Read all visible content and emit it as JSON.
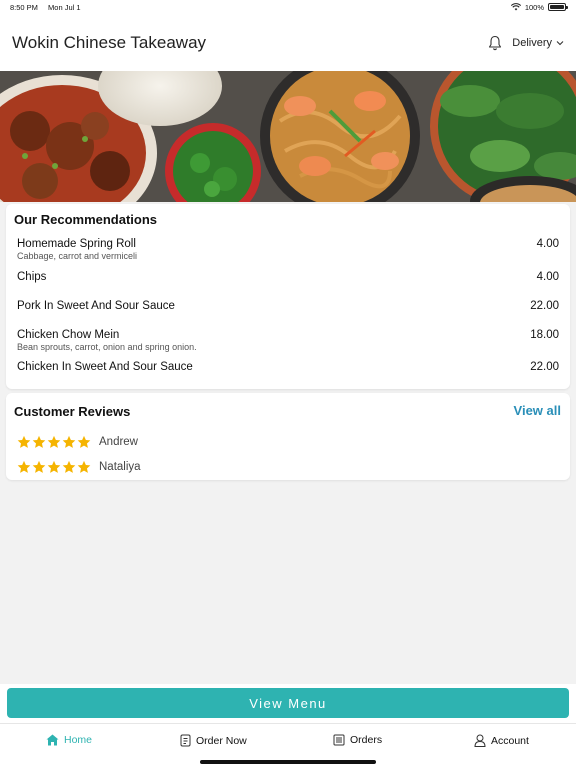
{
  "status_bar": {
    "time": "8:50 PM",
    "date": "Mon Jul 1",
    "battery": "100%"
  },
  "header": {
    "title": "Wokin Chinese Takeaway",
    "mode_label": "Delivery"
  },
  "recommendations": {
    "title": "Our Recommendations",
    "items": [
      {
        "name": "Homemade Spring Roll",
        "desc": "Cabbage, carrot and vermiceli",
        "price": "4.00"
      },
      {
        "name": "Chips",
        "desc": "",
        "price": "4.00"
      },
      {
        "name": "Pork In Sweet And Sour Sauce",
        "desc": "",
        "price": "22.00"
      },
      {
        "name": "Chicken Chow Mein",
        "desc": "Bean sprouts, carrot, onion and spring onion.",
        "price": "18.00"
      },
      {
        "name": "Chicken In Sweet And Sour Sauce",
        "desc": "",
        "price": "22.00"
      }
    ]
  },
  "reviews": {
    "title": "Customer Reviews",
    "view_all_label": "View all",
    "items": [
      {
        "name": "Andrew",
        "rating": 5
      },
      {
        "name": "Nataliya",
        "rating": 5
      }
    ]
  },
  "view_menu_label": "View Menu",
  "tabs": [
    {
      "label": "Home",
      "icon": "home-icon",
      "active": true
    },
    {
      "label": "Order Now",
      "icon": "order-icon",
      "active": false
    },
    {
      "label": "Orders",
      "icon": "orders-icon",
      "active": false
    },
    {
      "label": "Account",
      "icon": "account-icon",
      "active": false
    }
  ],
  "colors": {
    "accent": "#2eb3b1",
    "link": "#2a8fb8",
    "star": "#f5b400"
  }
}
